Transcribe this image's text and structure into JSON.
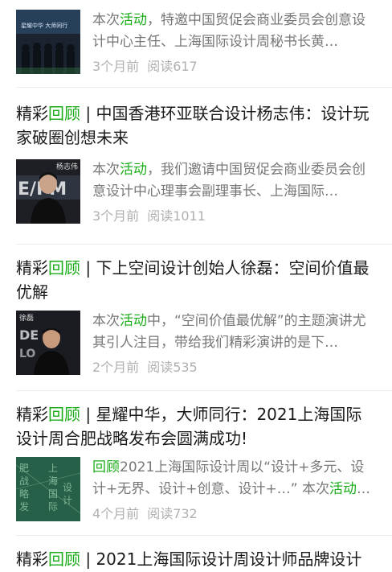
{
  "articles": [
    {
      "title_prefix": "",
      "title_highlight": "",
      "title_rest": "",
      "summary_pre": "本次",
      "summary_hl": "活动",
      "summary_post": "，特邀中国贸促会商业委员会创意设计中心主任、上海国际设计周秘书长黄…",
      "time": "3个月前",
      "reads": "阅读617",
      "thumb_icon": "event-stage-photo"
    },
    {
      "title_prefix": "精彩",
      "title_highlight": "回顾",
      "title_rest": " | 中国香港环亚联合设计杨志伟：设计玩家破圈创想未来",
      "summary_pre": "本次",
      "summary_hl": "活动",
      "summary_post": "，我们邀请中国贸促会商业委员会创意设计中心理事会副理事长、上海国际…",
      "time": "3个月前",
      "reads": "阅读1011",
      "thumb_caption": "杨志伟",
      "thumb_icon": "speaker-portrait"
    },
    {
      "title_prefix": "精彩",
      "title_highlight": "回顾",
      "title_rest": " | 下上空间设计创始人徐磊：空间价值最优解",
      "summary_pre": "本次",
      "summary_hl": "活动",
      "summary_post": "中，“空间价值最优解”的主题演讲尤其引人注目，带给我们精彩演讲的是下…",
      "time": "2个月前",
      "reads": "阅读535",
      "thumb_caption": "徐磊",
      "thumb_icon": "speaker-portrait"
    },
    {
      "title_prefix": "精彩",
      "title_highlight": "回顾",
      "title_rest": " | 星耀中华，大师同行：2021上海国际设计周合肥战略发布会圆满成功!",
      "summary_pre": "",
      "summary_hl": "回顾",
      "summary_post": "2021上海国际设计周以“设计+多元、设计+无界、设计+创意、设计+…” 本次",
      "summary_hl2": "活动",
      "summary_post2": "…",
      "time": "4个月前",
      "reads": "阅读732",
      "thumb_icon": "launch-event-poster"
    },
    {
      "title_prefix": "精彩",
      "title_highlight": "回顾",
      "title_rest": " | 2021上海国际设计周设计师品牌设计"
    }
  ],
  "colors": {
    "highlight": "#1aad19",
    "meta": "#b0b0b0",
    "summary": "#777777"
  }
}
